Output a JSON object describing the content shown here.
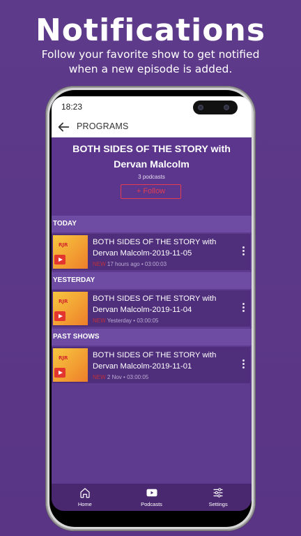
{
  "promo": {
    "title": "Notifications",
    "subtitle": "Follow your favorite show to get notified when a new episode is added."
  },
  "status_bar": {
    "time": "18:23"
  },
  "app_bar": {
    "title": "PROGRAMS",
    "back_icon": "arrow-left-icon"
  },
  "show": {
    "title": "BOTH SIDES OF THE STORY with Dervan Malcolm",
    "podcast_count": "3 podcasts",
    "follow_label": "+ Follow"
  },
  "sections": [
    {
      "label": "TODAY",
      "episode": {
        "title": "BOTH SIDES OF THE STORY with Dervan Malcolm-2019-11-05",
        "tag": "NEW",
        "when": "17 hours ago",
        "duration": "03:00:03"
      }
    },
    {
      "label": "YESTERDAY",
      "episode": {
        "title": "BOTH SIDES OF THE STORY with Dervan Malcolm-2019-11-04",
        "tag": "NEW",
        "when": "Yesterday",
        "duration": "03:00:05"
      }
    },
    {
      "label": "PAST SHOWS",
      "episode": {
        "title": "BOTH SIDES OF THE STORY with Dervan Malcolm-2019-11-01",
        "tag": "NEW",
        "when": "2 Nov",
        "duration": "03:00:05"
      }
    }
  ],
  "thumbnail_logo": "RJR",
  "meta_separator": "•",
  "bottom_nav": [
    {
      "label": "Home",
      "icon": "home-icon"
    },
    {
      "label": "Podcasts",
      "icon": "youtube-play-icon"
    },
    {
      "label": "Settings",
      "icon": "sliders-icon"
    }
  ],
  "colors": {
    "background": "#5e3a8a",
    "accent": "#e53c52",
    "section_header": "#6f4ca3",
    "episode_row": "#4f2e7b"
  }
}
